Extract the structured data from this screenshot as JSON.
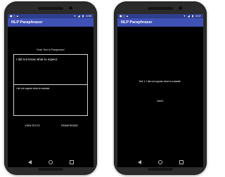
{
  "screens": [
    {
      "status": {
        "left": "◼ ◻ ▲",
        "wifi": "▾",
        "signal": "◢",
        "battery": "▮",
        "time": "6:55"
      },
      "app_title": "NLP Paraphraser",
      "prompt": "Enter Text to Paraphrase!",
      "input_value": "I did not know what to expect.",
      "output_value": "I did not cognize what to evaluate .",
      "button_view": "VIEW TEXTS",
      "button_paraphrase": "PARAPHRASE"
    },
    {
      "status": {
        "left": "◼ ◻ ▲",
        "wifi": "▾",
        "signal": "◢",
        "battery": "▮",
        "time": "6:57"
      },
      "app_title": "NLP Paraphraser",
      "result_text": "Text 1: I did not cognize what to evaluate .",
      "button_back": "BACK"
    }
  ]
}
